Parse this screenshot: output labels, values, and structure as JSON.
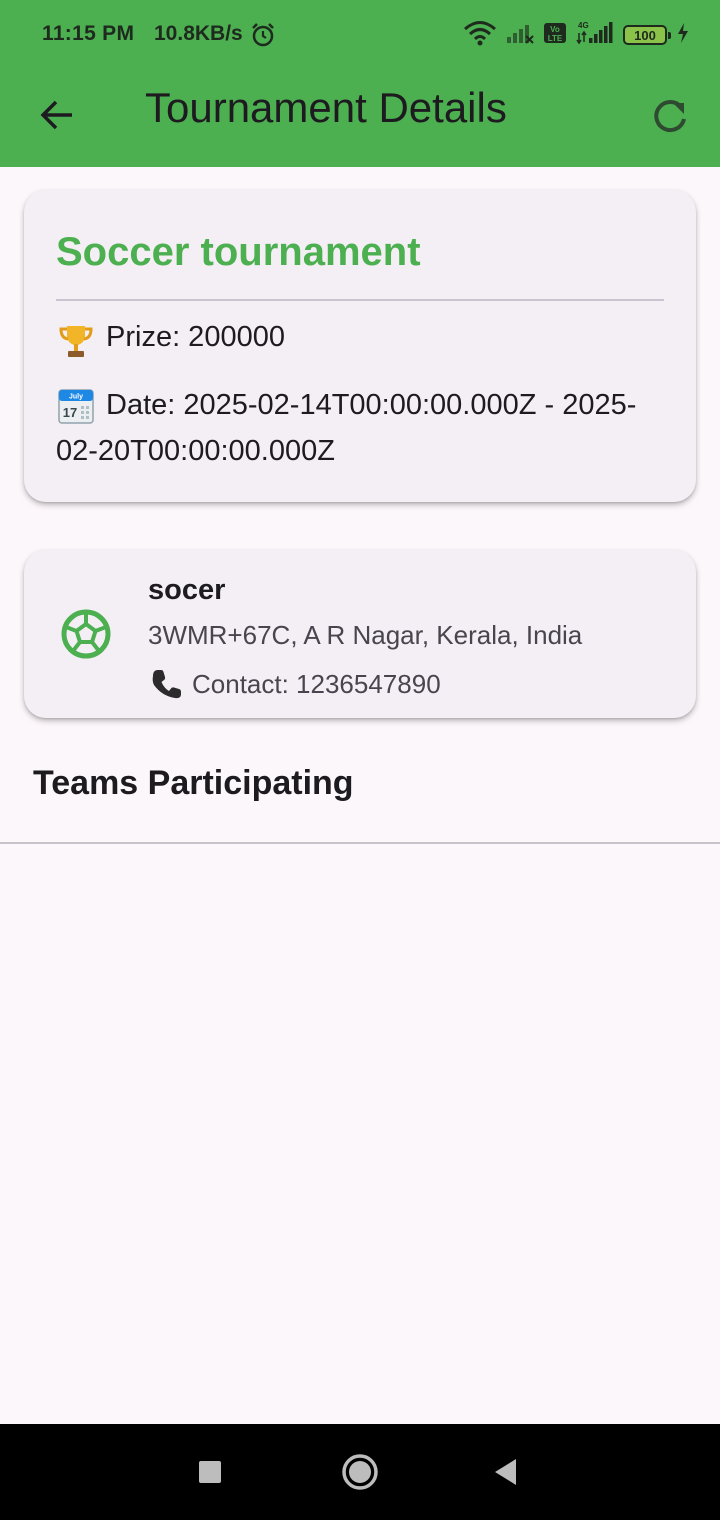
{
  "status_bar": {
    "time": "11:15 PM",
    "speed": "10.8KB/s",
    "battery": "100",
    "icons": [
      "alarm-icon",
      "wifi-icon",
      "signal-icon",
      "volte-icon",
      "4g-signal-icon",
      "battery-icon",
      "charging-icon"
    ]
  },
  "app_bar": {
    "title": "Tournament Details",
    "back_icon": "arrow-back-icon",
    "refresh_icon": "refresh-icon",
    "background": "#4caf50"
  },
  "tournament": {
    "name": "Soccer tournament",
    "prize_icon": "trophy-icon",
    "prize": "Prize: 200000",
    "date_icon": "calendar-icon",
    "date": "Date: 2025-02-14T00:00:00.000Z - 2025-02-20T00:00:00.000Z",
    "accent_color": "#4caf50"
  },
  "venue": {
    "icon": "soccer-ball-icon",
    "name": "socer",
    "address": "3WMR+67C, A R Nagar, Kerala, India",
    "contact_icon": "phone-icon",
    "contact": "Contact: 1236547890"
  },
  "teams": {
    "heading": "Teams Participating",
    "items": []
  },
  "nav_bar": {
    "icons": [
      "recents-square-icon",
      "home-circle-icon",
      "back-triangle-icon"
    ]
  }
}
